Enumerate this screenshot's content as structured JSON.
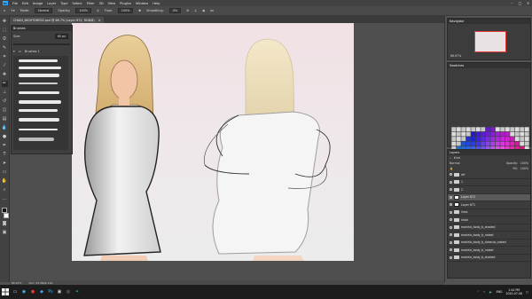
{
  "menubar": {
    "app_icon": "Ps",
    "items": [
      "File",
      "Edit",
      "Image",
      "Layer",
      "Type",
      "Select",
      "Filter",
      "3D",
      "View",
      "Plugins",
      "Window",
      "Help"
    ]
  },
  "options": {
    "mode_label": "Mode:",
    "mode_value": "Normal",
    "opacity_label": "Opacity:",
    "opacity_value": "100%",
    "flow_label": "Flow:",
    "flow_value": "100%",
    "smoothing_label": "Smoothing:",
    "smoothing_value": "0%"
  },
  "document": {
    "tab_title": "CHAIN_NIGHTDRESS.psd @ 66.7% (Layer 672, RGB/8)",
    "tab_close": "×"
  },
  "status": {
    "zoom": "66.67%",
    "doc_size": "Doc: 34.3M/4.11G"
  },
  "brushes_panel": {
    "title": "Brushes",
    "size_label": "Size:",
    "size_value": "60 px",
    "folder_label": "Brushes 1"
  },
  "navigator": {
    "title": "Navigator",
    "zoom": "66.67%"
  },
  "swatches": {
    "title": "Swatches"
  },
  "layers": {
    "title": "Layers",
    "kind_label": "Kind",
    "blend_value": "Normal",
    "opacity_label": "Opacity:",
    "opacity_value": "100%",
    "fill_label": "Fill:",
    "fill_value": "100%",
    "rows": [
      {
        "name": "ref",
        "type": "folder"
      },
      {
        "name": "1",
        "type": "folder"
      },
      {
        "name": "2",
        "type": "folder"
      },
      {
        "name": "Layer 672",
        "type": "layer",
        "selected": true
      },
      {
        "name": "Layer 671",
        "type": "layer"
      },
      {
        "name": "lines",
        "type": "folder"
      },
      {
        "name": "shad",
        "type": "folder"
      },
      {
        "name": "mariela_body_b_shaded",
        "type": "folder"
      },
      {
        "name": "mariela_body_b_naked",
        "type": "folder"
      },
      {
        "name": "mariela_body_b_cleanup_naked",
        "type": "folder"
      },
      {
        "name": "mariela_body_b_naked",
        "type": "folder"
      },
      {
        "name": "mariela_body_b_shaded",
        "type": "folder"
      }
    ]
  },
  "taskbar": {
    "time": "1:44 PM",
    "date": "2020-07-08",
    "lang": "ENG"
  },
  "colors": {
    "ps_blue": "#31a8ff",
    "panel_bg": "#3c3c3c",
    "canvas_bg": "#efe7ea"
  }
}
